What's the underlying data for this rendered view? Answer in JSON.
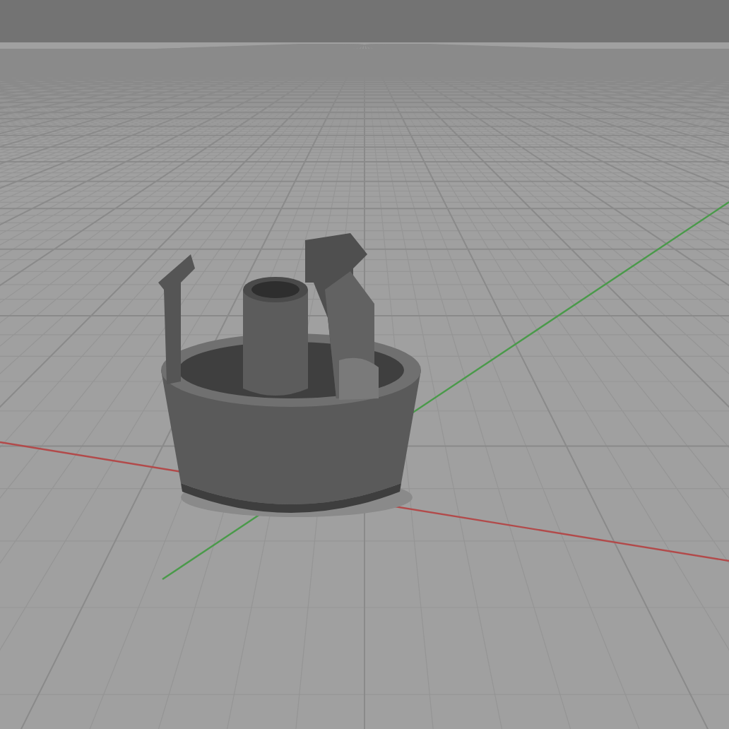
{
  "viewport": {
    "grid": true,
    "axes": [
      {
        "kind": "x",
        "color": "#b24a4a"
      },
      {
        "kind": "y",
        "color": "#4a9a4a"
      }
    ]
  }
}
